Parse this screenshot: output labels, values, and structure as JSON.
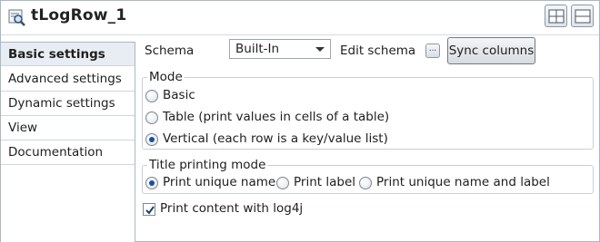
{
  "window": {
    "title": "tLogRow_1",
    "icon": "component-magnifier-icon"
  },
  "toolbar": {
    "layout_buttons": [
      "layout-horizontal-icon",
      "layout-vertical-icon"
    ]
  },
  "sidebar": {
    "items": [
      {
        "label": "Basic settings",
        "active": true
      },
      {
        "label": "Advanced settings",
        "active": false
      },
      {
        "label": "Dynamic settings",
        "active": false
      },
      {
        "label": "View",
        "active": false
      },
      {
        "label": "Documentation",
        "active": false
      }
    ]
  },
  "schema": {
    "label": "Schema",
    "value": "Built-In",
    "edit_label": "Edit schema",
    "edit_button": "...",
    "sync_button": "Sync columns"
  },
  "mode": {
    "title": "Mode",
    "options": [
      {
        "label": "Basic",
        "checked": false
      },
      {
        "label": "Table (print values in cells of a table)",
        "checked": false
      },
      {
        "label": "Vertical (each row is a key/value list)",
        "checked": true
      }
    ]
  },
  "title_printing": {
    "title": "Title printing mode",
    "options": [
      {
        "label": "Print unique name",
        "checked": true
      },
      {
        "label": "Print label",
        "checked": false
      },
      {
        "label": "Print unique name and label",
        "checked": false
      }
    ]
  },
  "log4j": {
    "label": "Print content with log4j",
    "checked": true
  },
  "colors": {
    "accent": "#1d4f9a",
    "active_tab_bg": "#e8edf3",
    "border": "#a9b7c6"
  }
}
